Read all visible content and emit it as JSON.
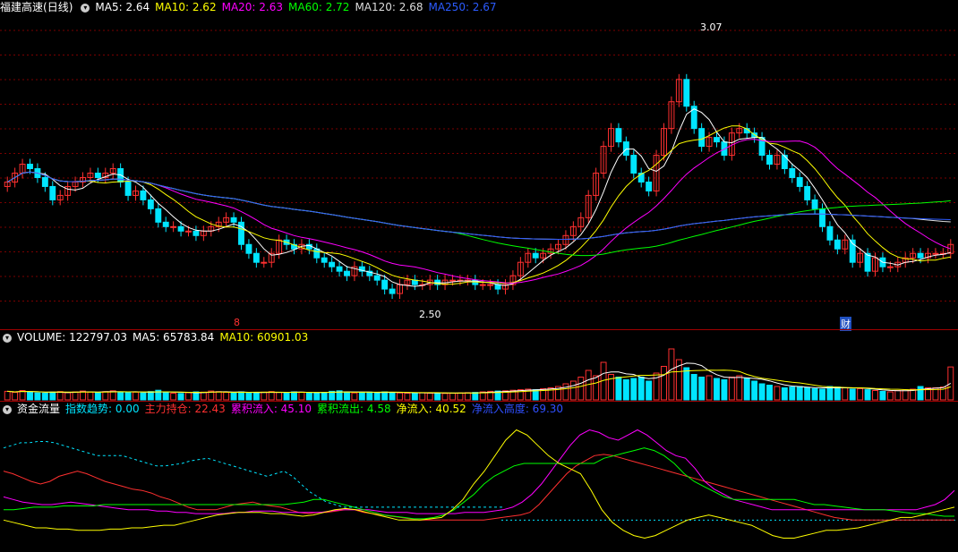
{
  "header": {
    "stock_name": "福建高速",
    "period": "(日线)",
    "ma": [
      {
        "label": "MA5: 2.64",
        "color": "#ffffff"
      },
      {
        "label": "MA10: 2.62",
        "color": "#ffff00"
      },
      {
        "label": "MA20: 2.63",
        "color": "#ff00ff"
      },
      {
        "label": "MA60: 2.72",
        "color": "#00ff00"
      },
      {
        "label": "MA120: 2.68",
        "color": "#dddddd"
      },
      {
        "label": "MA250: 2.67",
        "color": "#2b5bff"
      }
    ]
  },
  "volume_header": {
    "items": [
      {
        "label": "VOLUME: 122797.03",
        "color": "#ffffff"
      },
      {
        "label": "MA5: 65783.84",
        "color": "#ffffff"
      },
      {
        "label": "MA10: 60901.03",
        "color": "#ffff00"
      }
    ]
  },
  "flow_header": {
    "title": "资金流量",
    "items": [
      {
        "label": "指数趋势: 0.00",
        "color": "#00e5ff"
      },
      {
        "label": "主力持仓: 22.43",
        "color": "#ff3030"
      },
      {
        "label": "累积流入: 45.10",
        "color": "#ff00ff"
      },
      {
        "label": "累积流出: 4.58",
        "color": "#00ff00"
      },
      {
        "label": "净流入: 40.52",
        "color": "#ffff00"
      },
      {
        "label": "净流入高度: 69.30",
        "color": "#3050ff"
      }
    ]
  },
  "markers": {
    "high_label": "3.07",
    "low_label": "2.50",
    "event_1": "8",
    "event_2": "财"
  },
  "chart_data": [
    {
      "type": "candlestick",
      "ylim": [
        2.45,
        3.12
      ],
      "high": 3.07,
      "low": 2.5,
      "close": [
        2.76,
        2.78,
        2.8,
        2.79,
        2.77,
        2.75,
        2.72,
        2.73,
        2.75,
        2.76,
        2.77,
        2.78,
        2.77,
        2.78,
        2.79,
        2.76,
        2.73,
        2.74,
        2.72,
        2.7,
        2.67,
        2.66,
        2.66,
        2.65,
        2.65,
        2.64,
        2.65,
        2.66,
        2.67,
        2.68,
        2.67,
        2.62,
        2.6,
        2.58,
        2.58,
        2.6,
        2.63,
        2.62,
        2.61,
        2.62,
        2.61,
        2.59,
        2.58,
        2.57,
        2.56,
        2.55,
        2.57,
        2.56,
        2.55,
        2.54,
        2.52,
        2.51,
        2.53,
        2.54,
        2.53,
        2.53,
        2.54,
        2.53,
        2.54,
        2.54,
        2.54,
        2.54,
        2.53,
        2.53,
        2.53,
        2.52,
        2.53,
        2.55,
        2.58,
        2.6,
        2.59,
        2.6,
        2.61,
        2.62,
        2.64,
        2.66,
        2.68,
        2.73,
        2.78,
        2.84,
        2.88,
        2.85,
        2.82,
        2.78,
        2.76,
        2.74,
        2.82,
        2.88,
        2.94,
        2.99,
        2.93,
        2.88,
        2.84,
        2.86,
        2.85,
        2.82,
        2.87,
        2.88,
        2.87,
        2.86,
        2.82,
        2.8,
        2.82,
        2.79,
        2.77,
        2.75,
        2.72,
        2.7,
        2.66,
        2.63,
        2.61,
        2.63,
        2.58,
        2.6,
        2.56,
        2.59,
        2.57,
        2.57,
        2.58,
        2.59,
        2.6,
        2.59,
        2.6,
        2.6,
        2.6,
        2.62
      ]
    },
    {
      "type": "bar",
      "name": "VOLUME",
      "ylim": [
        0,
        200000
      ],
      "values": [
        32000,
        28000,
        35000,
        30000,
        26000,
        25000,
        29000,
        31000,
        27000,
        30000,
        33000,
        29000,
        28000,
        31000,
        34000,
        30000,
        27000,
        29000,
        26000,
        31000,
        36000,
        28000,
        25000,
        24000,
        27000,
        30000,
        29000,
        33000,
        31000,
        28000,
        26000,
        30000,
        27000,
        25000,
        29000,
        31000,
        28000,
        27000,
        30000,
        29000,
        26000,
        27000,
        28000,
        32000,
        34000,
        29000,
        26000,
        27000,
        29000,
        28000,
        30000,
        27000,
        26000,
        25000,
        26000,
        27000,
        25000,
        26000,
        24000,
        25000,
        26000,
        27000,
        28000,
        30000,
        32000,
        33000,
        34000,
        36000,
        38000,
        40000,
        38000,
        42000,
        45000,
        50000,
        60000,
        70000,
        85000,
        110000,
        90000,
        140000,
        95000,
        85000,
        75000,
        80000,
        85000,
        70000,
        100000,
        125000,
        190000,
        150000,
        120000,
        95000,
        85000,
        90000,
        80000,
        75000,
        85000,
        90000,
        80000,
        70000,
        60000,
        55000,
        50000,
        45000,
        48000,
        50000,
        45000,
        42000,
        40000,
        50000,
        48000,
        45000,
        40000,
        42000,
        38000,
        35000,
        32000,
        30000,
        35000,
        38000,
        40000,
        50000,
        45000,
        45000,
        48000,
        122797
      ]
    },
    {
      "type": "line",
      "name": "资金流量",
      "ylim": [
        0,
        100
      ],
      "series": [
        {
          "name": "主力持仓",
          "color": "#ff3030",
          "values": [
            60,
            58,
            55,
            52,
            50,
            52,
            56,
            58,
            60,
            58,
            55,
            52,
            50,
            48,
            46,
            45,
            43,
            40,
            38,
            35,
            32,
            30,
            30,
            30,
            32,
            34,
            35,
            36,
            34,
            33,
            32,
            30,
            28,
            27,
            28,
            28,
            29,
            30,
            30,
            28,
            27,
            26,
            25,
            24,
            23,
            22,
            22,
            22,
            22,
            22,
            22,
            22,
            22,
            23,
            24,
            25,
            26,
            28,
            34,
            42,
            50,
            58,
            64,
            68,
            72,
            73,
            72,
            70,
            68,
            66,
            64,
            62,
            60,
            58,
            56,
            54,
            52,
            50,
            48,
            46,
            44,
            42,
            40,
            38,
            36,
            34,
            32,
            30,
            28,
            26,
            24,
            23,
            22,
            22,
            22,
            22,
            22,
            22,
            22,
            22,
            22,
            22,
            22,
            22
          ]
        },
        {
          "name": "累积流入",
          "color": "#ff00ff",
          "values": [
            40,
            38,
            36,
            35,
            34,
            34,
            35,
            36,
            35,
            34,
            33,
            32,
            31,
            30,
            30,
            30,
            29,
            29,
            28,
            28,
            27,
            27,
            27,
            27,
            28,
            28,
            29,
            29,
            29,
            28,
            28,
            28,
            28,
            28,
            29,
            30,
            30,
            30,
            30,
            29,
            28,
            28,
            28,
            27,
            27,
            27,
            27,
            27,
            28,
            28,
            28,
            29,
            30,
            32,
            36,
            42,
            50,
            60,
            70,
            80,
            88,
            92,
            90,
            86,
            84,
            88,
            92,
            88,
            82,
            76,
            72,
            70,
            62,
            52,
            46,
            42,
            38,
            36,
            34,
            32,
            30,
            30,
            30,
            30,
            30,
            30,
            30,
            30,
            30,
            30,
            30,
            30,
            30,
            30,
            30,
            30,
            32,
            34,
            38,
            45
          ]
        },
        {
          "name": "累积流出",
          "color": "#00ff00",
          "values": [
            30,
            30,
            31,
            32,
            32,
            32,
            33,
            33,
            33,
            33,
            34,
            34,
            34,
            34,
            34,
            34,
            34,
            34,
            34,
            34,
            34,
            34,
            34,
            34,
            34,
            34,
            34,
            34,
            34,
            35,
            36,
            38,
            38,
            36,
            34,
            32,
            30,
            28,
            26,
            25,
            24,
            23,
            23,
            24,
            26,
            30,
            36,
            42,
            50,
            56,
            60,
            64,
            66,
            66,
            66,
            66,
            66,
            66,
            66,
            66,
            70,
            72,
            74,
            76,
            78,
            76,
            72,
            66,
            58,
            52,
            48,
            44,
            40,
            38,
            38,
            38,
            38,
            38,
            38,
            38,
            36,
            34,
            34,
            33,
            32,
            31,
            30,
            30,
            30,
            29,
            28,
            27,
            27,
            26,
            25,
            25
          ]
        },
        {
          "name": "净流入",
          "color": "#ffff00",
          "values": [
            22,
            20,
            18,
            16,
            16,
            15,
            15,
            14,
            14,
            14,
            15,
            15,
            16,
            16,
            17,
            18,
            18,
            20,
            22,
            24,
            26,
            27,
            28,
            28,
            28,
            27,
            27,
            26,
            25,
            26,
            28,
            30,
            31,
            30,
            28,
            26,
            24,
            22,
            22,
            22,
            23,
            24,
            30,
            38,
            50,
            60,
            72,
            84,
            92,
            88,
            80,
            72,
            66,
            62,
            58,
            45,
            30,
            20,
            14,
            10,
            8,
            10,
            14,
            18,
            22,
            24,
            26,
            24,
            22,
            20,
            18,
            14,
            10,
            8,
            8,
            10,
            12,
            14,
            14,
            15,
            16,
            18,
            20,
            22,
            24,
            24,
            26,
            28,
            30,
            32
          ]
        },
        {
          "name": "指数趋势",
          "color": "#00e5ff",
          "dashed": true,
          "values": [
            78,
            80,
            82,
            82,
            83,
            83,
            82,
            80,
            78,
            76,
            74,
            72,
            72,
            72,
            72,
            70,
            68,
            66,
            64,
            64,
            65,
            66,
            68,
            69,
            70,
            68,
            66,
            64,
            62,
            60,
            58,
            56,
            58,
            60,
            56,
            50,
            44,
            40,
            36,
            34,
            32,
            32,
            32,
            32,
            32,
            32,
            32,
            32,
            32,
            32,
            32,
            32,
            32,
            32,
            32,
            32,
            32,
            32,
            32,
            32
          ]
        }
      ]
    }
  ]
}
